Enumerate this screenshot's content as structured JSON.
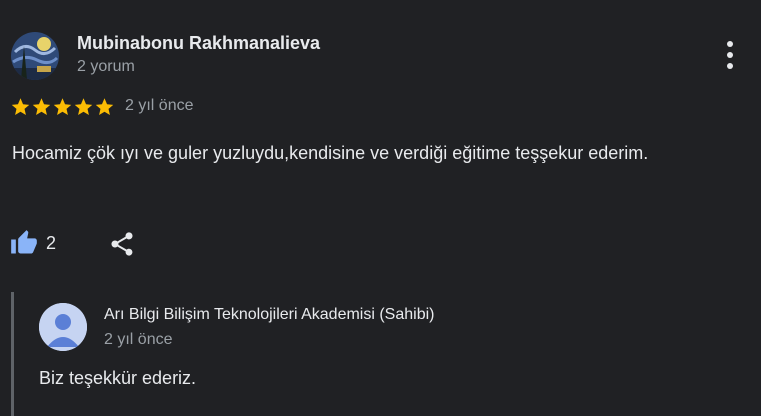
{
  "review": {
    "reviewer_name": "Mubinabonu Rakhmanalieva",
    "review_count": "2 yorum",
    "rating": 5,
    "rating_max": 5,
    "date": "2 yıl önce",
    "text": "Hocamiz çök ıyı ve guler yuzluydu,kendisine ve verdiği eğitime teşşekur ederim.",
    "likes": "2",
    "star_color": "#fbbc04"
  },
  "reply": {
    "owner_name": "Arı Bilgi Bilişim Teknolojileri Akademisi (Sahibi)",
    "date": "2 yıl önce",
    "text": "Biz teşekkür ederiz."
  },
  "icons": {
    "more": "more-vertical-icon",
    "like": "thumbs-up-icon",
    "share": "share-icon",
    "default_avatar": "person-icon"
  },
  "colors": {
    "background": "#202124",
    "primary_text": "#e8eaed",
    "secondary_text": "#9aa0a6",
    "like_icon": "#8ab4f8"
  }
}
